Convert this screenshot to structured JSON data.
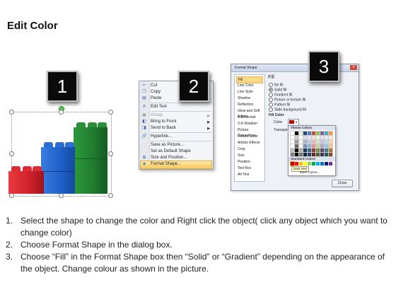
{
  "page": {
    "title": "Edit Color"
  },
  "badges": [
    "1",
    "2",
    "3"
  ],
  "context_menu": {
    "items": [
      {
        "label": "Cut",
        "icon": "scissors-icon",
        "glyph": "✂",
        "enabled": true
      },
      {
        "label": "Copy",
        "icon": "copy-icon",
        "glyph": "❐",
        "enabled": true
      },
      {
        "label": "Paste",
        "icon": "paste-icon",
        "glyph": "▤",
        "enabled": true
      },
      {
        "label": "Edit Text",
        "icon": "edit-text-icon",
        "glyph": "A",
        "enabled": true
      },
      {
        "label": "Group",
        "icon": "group-icon",
        "glyph": "▣",
        "enabled": false,
        "submenu": true
      },
      {
        "label": "Bring to Front",
        "icon": "bring-to-front-icon",
        "glyph": "◧",
        "enabled": true,
        "submenu": true
      },
      {
        "label": "Send to Back",
        "icon": "send-to-back-icon",
        "glyph": "◨",
        "enabled": true,
        "submenu": true
      },
      {
        "label": "Hyperlink...",
        "icon": "hyperlink-icon",
        "glyph": "🔗",
        "enabled": true
      },
      {
        "label": "Save as Picture...",
        "icon": "save-picture-icon",
        "glyph": "",
        "enabled": true
      },
      {
        "label": "Set as Default Shape",
        "icon": "default-shape-icon",
        "glyph": "",
        "enabled": true
      },
      {
        "label": "Size and Position...",
        "icon": "size-position-icon",
        "glyph": "⊞",
        "enabled": true
      },
      {
        "label": "Format Shape...",
        "icon": "format-shape-icon",
        "glyph": "◈",
        "enabled": true,
        "highlighted": true
      }
    ]
  },
  "format_dialog": {
    "title": "Format Shape",
    "close_label": "Close",
    "categories": [
      "Fill",
      "Line Color",
      "Line Style",
      "Shadow",
      "Reflection",
      "Glow and Soft Edges",
      "3-D Format",
      "3-D Rotation",
      "Picture Corrections",
      "Picture Color",
      "Artistic Effects",
      "Crop",
      "Size",
      "Position",
      "Text Box",
      "Alt Text"
    ],
    "selected_category": "Fill",
    "fill_heading": "Fill",
    "fill_options": [
      {
        "label": "No fill",
        "selected": false
      },
      {
        "label": "Solid fill",
        "selected": true
      },
      {
        "label": "Gradient fill",
        "selected": false
      },
      {
        "label": "Picture or texture fill",
        "selected": false
      },
      {
        "label": "Pattern fill",
        "selected": false
      },
      {
        "label": "Slide background fill",
        "selected": false
      }
    ],
    "fill_color_label": "Fill Color",
    "color_label": "Color:",
    "transparency_label": "Transparency:",
    "palette": {
      "theme_label": "Theme Colors",
      "standard_label": "Standard Colors",
      "tooltip": "Dark Red",
      "more_label": "More Colors...",
      "theme_top_row": [
        "#ffffff",
        "#000000",
        "#eeece1",
        "#1f497d",
        "#4f81bd",
        "#c0504d",
        "#9bbb59",
        "#8064a2",
        "#4bacc6",
        "#f79646"
      ],
      "standard_row": [
        "#c00000",
        "#ff0000",
        "#ffc000",
        "#ffff00",
        "#92d050",
        "#00b050",
        "#00b0f0",
        "#0070c0",
        "#002060",
        "#7030a0"
      ]
    }
  },
  "colors": {
    "red": "#d0202a",
    "blue": "#1e5fc8",
    "green": "#1f7a2e"
  },
  "instructions": [
    "Select the shape to change the color and Right click the object( click any object which you want to change color)",
    "Choose Format Shape in the dialog box.",
    "Choose “Fill” in the Format Shape box then “Solid” or “Gradient” depending on the appearance of the object. Change colour as shown in the picture."
  ]
}
